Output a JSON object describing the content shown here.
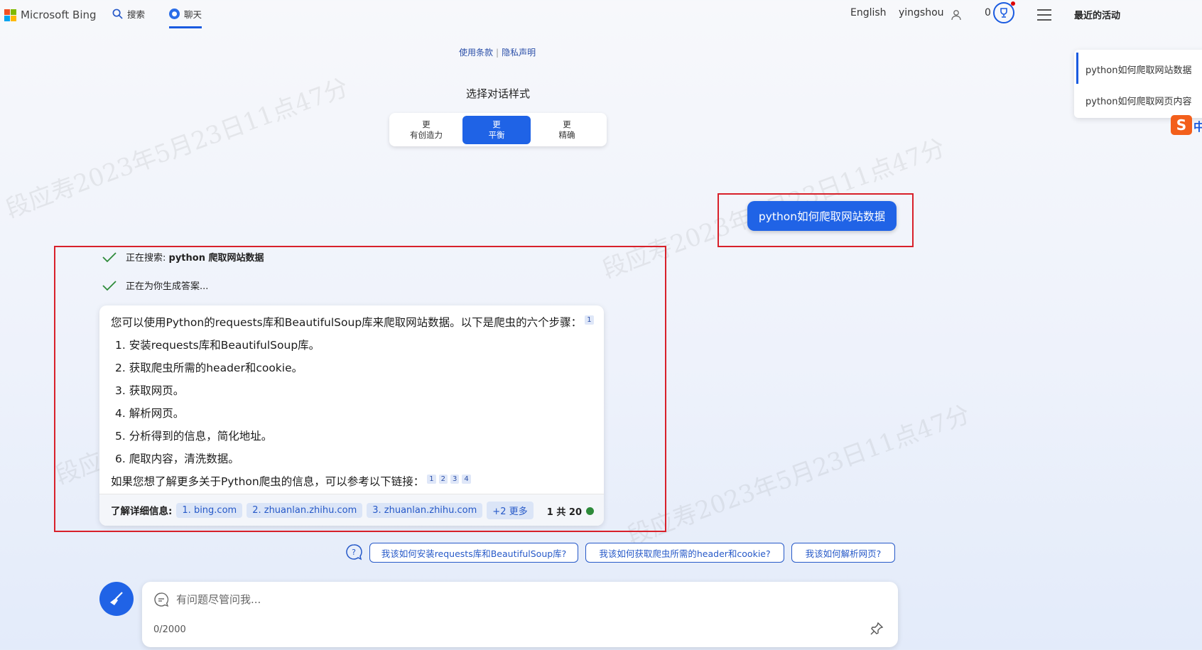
{
  "header": {
    "brand": "Microsoft Bing",
    "nav": {
      "search_label": "搜索",
      "chat_label": "聊天"
    },
    "language": "English",
    "username": "yingshou",
    "points": "0"
  },
  "sidebar": {
    "title": "最近的活动",
    "items": [
      {
        "label": "python如何爬取网站数据"
      },
      {
        "label": "python如何爬取网页内容"
      }
    ],
    "ime_badge": "中"
  },
  "links": {
    "terms": "使用条款",
    "privacy": "隐私声明"
  },
  "style_picker": {
    "title": "选择对话样式",
    "options": [
      {
        "line1": "更",
        "line2": "有创造力",
        "active": false
      },
      {
        "line1": "更",
        "line2": "平衡",
        "active": true
      },
      {
        "line1": "更",
        "line2": "精确",
        "active": false
      }
    ]
  },
  "user_message": "python如何爬取网站数据",
  "progress": {
    "searching_prefix": "正在搜索: ",
    "searching_query": "python 爬取网站数据",
    "generating": "正在为你生成答案..."
  },
  "answer": {
    "intro": "您可以使用Python的requests库和BeautifulSoup库来爬取网站数据。以下是爬虫的六个步骤：",
    "intro_cite": "1",
    "steps": [
      "1. 安装requests库和BeautifulSoup库。",
      "2. 获取爬虫所需的header和cookie。",
      "3. 获取网页。",
      "4. 解析网页。",
      "5. 分析得到的信息，简化地址。",
      "6. 爬取内容，清洗数据。"
    ],
    "outro": "如果您想了解更多关于Python爬虫的信息，可以参考以下链接：",
    "outro_cites": [
      "1",
      "2",
      "3",
      "4"
    ],
    "footer": {
      "label": "了解详细信息:",
      "sources": [
        "1. bing.com",
        "2. zhuanlan.zhihu.com",
        "3. zhuanlan.zhihu.com"
      ],
      "more": "+2 更多",
      "turn_count": "1 共 20"
    }
  },
  "suggestions": [
    "我该如何安装requests库和BeautifulSoup库?",
    "我该如何获取爬虫所需的header和cookie?",
    "我该如何解析网页?"
  ],
  "input": {
    "placeholder": "有问题尽管问我...",
    "char_count": "0/2000"
  },
  "watermark": "段应寿2023年5月23日11点47分",
  "colors": {
    "accent": "#1f63e6",
    "highlight_box": "#d8202a",
    "status_green": "#2e8b3a"
  }
}
